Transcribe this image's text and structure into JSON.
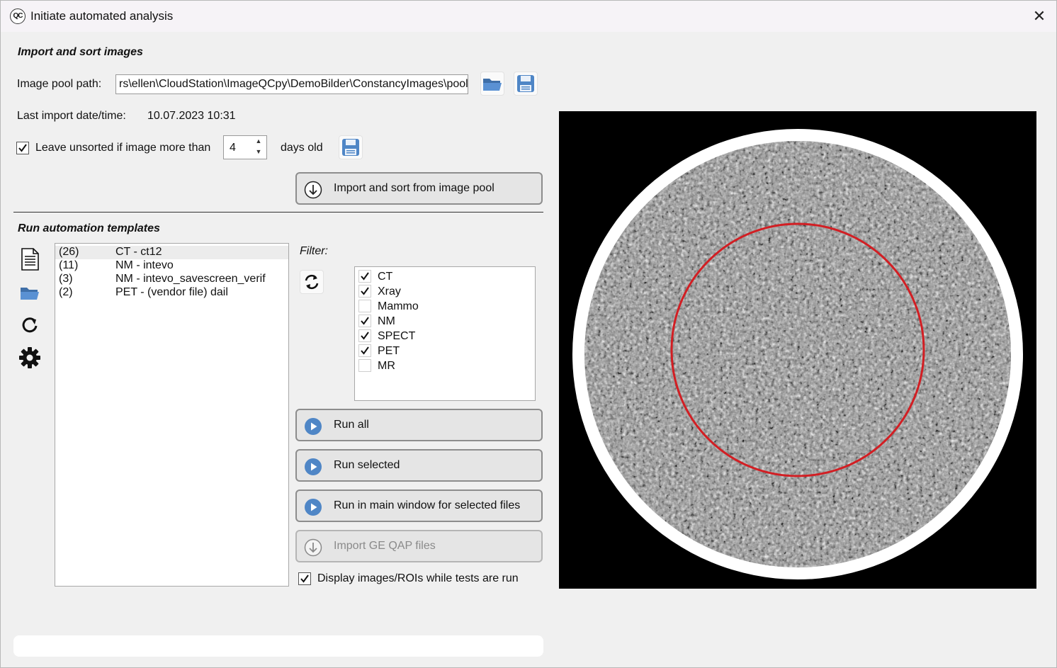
{
  "window": {
    "title": "Initiate automated analysis",
    "app_icon_text": "QC",
    "close_glyph": "✕"
  },
  "import_section": {
    "heading": "Import and sort images",
    "image_pool_label": "Image pool path:",
    "image_pool_path": "rs\\ellen\\CloudStation\\ImageQCpy\\DemoBilder\\ConstancyImages\\pool",
    "browse_icon": "folder-open-icon",
    "save_path_icon": "save-icon",
    "last_import_label": "Last import date/time:",
    "last_import_value": "10.07.2023 10:31",
    "leave_unsorted_checked": true,
    "leave_unsorted_label": "Leave unsorted if image more than",
    "days_value": "4",
    "days_suffix": "days old",
    "import_button_label": "Import and sort from image pool"
  },
  "automation_section": {
    "heading": "Run automation templates",
    "side_icons": [
      "document-icon",
      "folder-open-icon",
      "refresh-icon",
      "gear-icon"
    ],
    "templates": [
      {
        "count": "(26)",
        "name": "CT - ct12",
        "selected": true
      },
      {
        "count": "(11)",
        "name": "NM - intevo",
        "selected": false
      },
      {
        "count": "(3)",
        "name": "NM - intevo_savescreen_verif",
        "selected": false
      },
      {
        "count": "(2)",
        "name": "PET - (vendor file) dail",
        "selected": false
      }
    ],
    "filter_label": "Filter:",
    "filters": [
      {
        "label": "CT",
        "checked": true
      },
      {
        "label": "Xray",
        "checked": true
      },
      {
        "label": "Mammo",
        "checked": false
      },
      {
        "label": "NM",
        "checked": true
      },
      {
        "label": "SPECT",
        "checked": true
      },
      {
        "label": "PET",
        "checked": true
      },
      {
        "label": "MR",
        "checked": false
      }
    ],
    "run_all_label": "Run all",
    "run_selected_label": "Run selected",
    "run_main_label": "Run in main window for selected files",
    "import_ge_label": "Import GE QAP files",
    "display_images_checked": true,
    "display_images_label": "Display images/ROIs while tests are run"
  },
  "progress": {
    "value": 0
  },
  "colors": {
    "window_bg": "#f0f0f0",
    "titlebar_bg": "#f6f3f7",
    "button_bg": "#e5e5e5",
    "icon_blue": "#4f86c6",
    "roi_red": "#d21e23"
  }
}
